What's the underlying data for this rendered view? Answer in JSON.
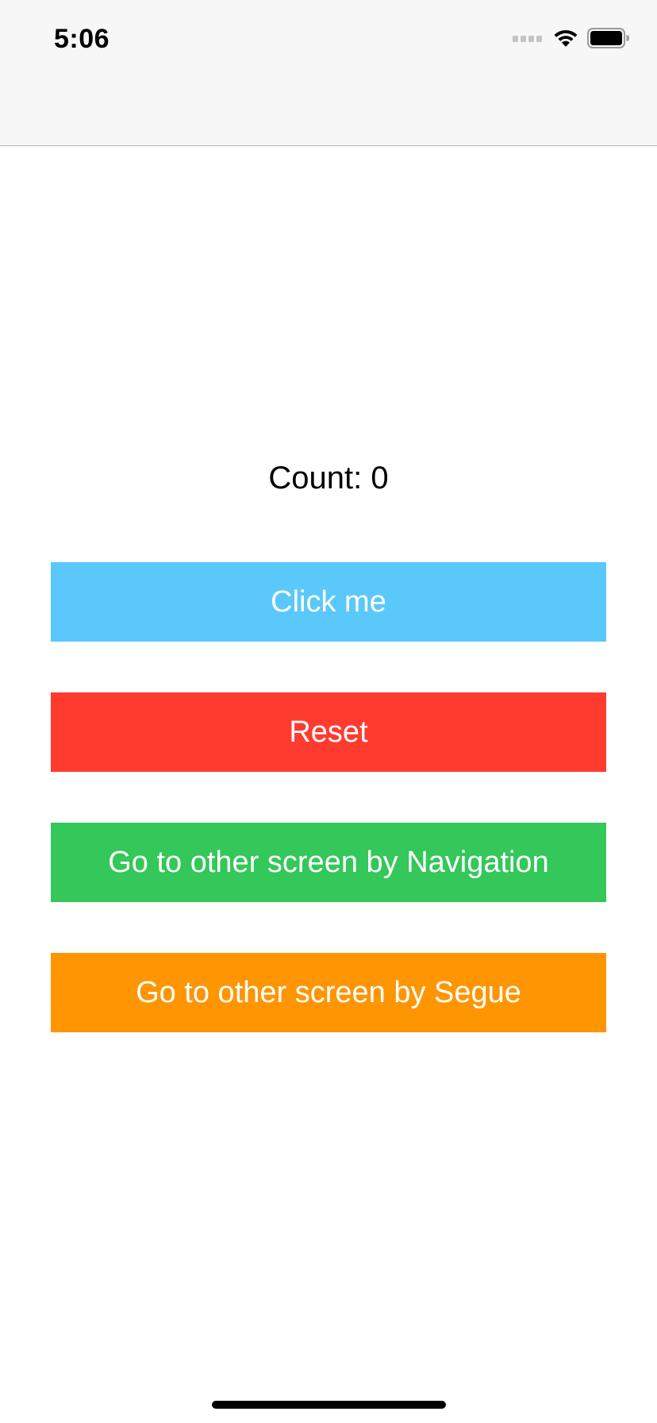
{
  "status_bar": {
    "time": "5:06",
    "icons": [
      "cellular-signal-icon",
      "wifi-icon",
      "battery-icon"
    ]
  },
  "main": {
    "count_label": "Count: 0",
    "buttons": [
      {
        "label": "Click me",
        "color": "#5ac8fa"
      },
      {
        "label": "Reset",
        "color": "#ff3b30"
      },
      {
        "label": "Go to other screen by Navigation",
        "color": "#34c759"
      },
      {
        "label": "Go to other screen by Segue",
        "color": "#ff9500"
      }
    ]
  },
  "colors": {
    "nav_bar_background": "#f7f7f7",
    "page_background": "#ffffff",
    "text": "#000000"
  }
}
